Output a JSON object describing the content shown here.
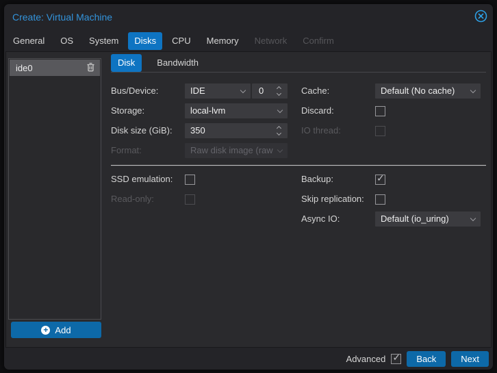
{
  "dialog": {
    "title": "Create: Virtual Machine",
    "tabs": [
      {
        "label": "General",
        "state": "normal"
      },
      {
        "label": "OS",
        "state": "normal"
      },
      {
        "label": "System",
        "state": "normal"
      },
      {
        "label": "Disks",
        "state": "active"
      },
      {
        "label": "CPU",
        "state": "normal"
      },
      {
        "label": "Memory",
        "state": "normal"
      },
      {
        "label": "Network",
        "state": "disabled"
      },
      {
        "label": "Confirm",
        "state": "disabled"
      }
    ]
  },
  "disk_list": {
    "items": [
      {
        "label": "ide0",
        "selected": true
      }
    ],
    "add_label": "Add"
  },
  "disk_panel": {
    "tabs": [
      {
        "label": "Disk",
        "state": "active"
      },
      {
        "label": "Bandwidth",
        "state": "normal"
      }
    ],
    "fields": {
      "bus_device": {
        "label": "Bus/Device:",
        "value": "IDE",
        "number": "0"
      },
      "cache": {
        "label": "Cache:",
        "value": "Default (No cache)"
      },
      "storage": {
        "label": "Storage:",
        "value": "local-lvm"
      },
      "discard": {
        "label": "Discard:",
        "checked": false
      },
      "disk_size": {
        "label": "Disk size (GiB):",
        "value": "350"
      },
      "io_thread": {
        "label": "IO thread:",
        "checked": false,
        "disabled": true
      },
      "format": {
        "label": "Format:",
        "value": "Raw disk image (raw",
        "disabled": true
      },
      "ssd_emulation": {
        "label": "SSD emulation:",
        "checked": false
      },
      "backup": {
        "label": "Backup:",
        "checked": true
      },
      "read_only": {
        "label": "Read-only:",
        "checked": false,
        "disabled": true
      },
      "skip_replication": {
        "label": "Skip replication:",
        "checked": false
      },
      "async_io": {
        "label": "Async IO:",
        "value": "Default (io_uring)"
      }
    }
  },
  "footer": {
    "advanced_label": "Advanced",
    "advanced_checked": true,
    "back_label": "Back",
    "next_label": "Next"
  },
  "colors": {
    "title_blue": "#3394dc",
    "tab_active_blue": "#0e74c2",
    "button_blue": "#0d69a8",
    "panel_bg": "#2a2a2d",
    "field_bg": "#3b3b3f"
  }
}
